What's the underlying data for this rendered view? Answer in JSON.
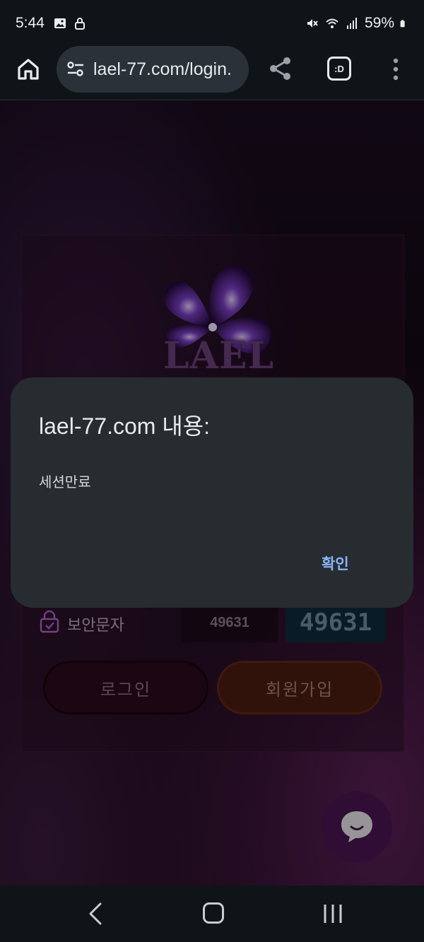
{
  "status_bar": {
    "time": "5:44",
    "battery": "59%"
  },
  "browser": {
    "url": "lael-77.com/login.",
    "tabs_label": ":D"
  },
  "page": {
    "logo_text": "LAEL",
    "captcha_label": "보안문자",
    "captcha_input_value": "49631",
    "captcha_image_text": "49631",
    "login_button": "로그인",
    "signup_button": "회원가입"
  },
  "dialog": {
    "title": "lael-77.com 내용:",
    "message": "세션만료",
    "ok_button": "확인"
  },
  "colors": {
    "dialog_bg": "#262c30",
    "accent": "#8ab4f8",
    "chat_fab": "#4b1552"
  }
}
